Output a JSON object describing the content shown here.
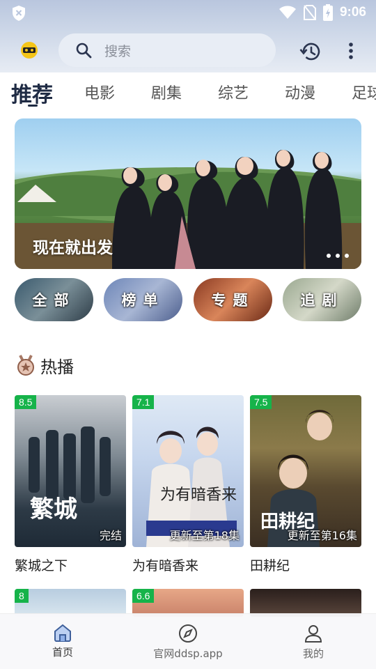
{
  "status_bar": {
    "time": "9:06"
  },
  "header": {
    "search_placeholder": "搜索"
  },
  "tabs": [
    {
      "label": "推荐",
      "active": true
    },
    {
      "label": "电影"
    },
    {
      "label": "剧集"
    },
    {
      "label": "综艺"
    },
    {
      "label": "动漫"
    },
    {
      "label": "足球"
    }
  ],
  "banner": {
    "caption": "现在就出发"
  },
  "quick_links": [
    {
      "label": "全部"
    },
    {
      "label": "榜单"
    },
    {
      "label": "专题"
    },
    {
      "label": "追剧"
    }
  ],
  "hot_section": {
    "title": "热播",
    "items": [
      {
        "title": "繁城之下",
        "score": "8.5",
        "status": "完结"
      },
      {
        "title": "为有暗香来",
        "score": "7.1",
        "status": "更新至第18集"
      },
      {
        "title": "田耕纪",
        "score": "7.5",
        "status": "更新至第16集"
      },
      {
        "score": "8"
      },
      {
        "score": "6.6"
      },
      {}
    ]
  },
  "bottom_nav": [
    {
      "label": "首页",
      "icon": "home-icon",
      "active": true
    },
    {
      "label": "官网ddsp.app",
      "icon": "compass-icon"
    },
    {
      "label": "我的",
      "icon": "user-icon"
    }
  ],
  "colors": {
    "accent": "#1f2b44",
    "score_badge": "#16b34a",
    "status_bar": "#b9c6de"
  }
}
